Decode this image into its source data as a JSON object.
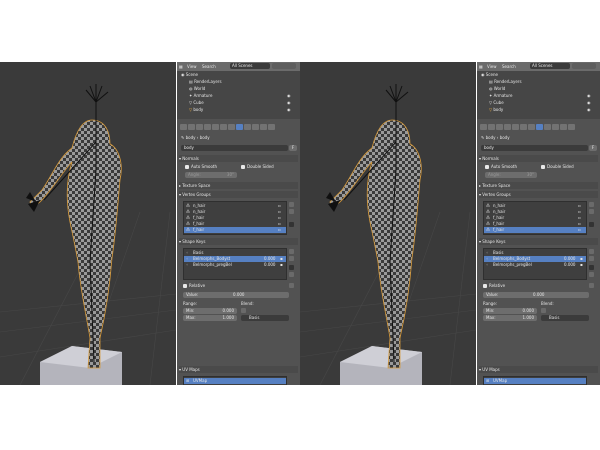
{
  "outliner": {
    "view_menu": "View",
    "search_menu": "Search",
    "scenes_filter": "All Scenes",
    "items": [
      {
        "label": "Scene",
        "indent": 0
      },
      {
        "label": "RenderLayers",
        "indent": 1
      },
      {
        "label": "World",
        "indent": 1
      },
      {
        "label": "Armature",
        "indent": 1
      },
      {
        "label": "Cube",
        "indent": 1
      },
      {
        "label": "body",
        "indent": 1
      }
    ]
  },
  "properties": {
    "breadcrumb_object": "body",
    "breadcrumb_mesh": "body",
    "mesh_name": "body",
    "mesh_badge": "F",
    "normals": {
      "title": "Normals",
      "auto_smooth": "Auto Smooth",
      "double_sided": "Double Sided",
      "angle": "Angle:",
      "angle_value": "30°"
    },
    "texture_space": "Texture Space",
    "vertex_groups": {
      "title": "Vertex Groups",
      "items": [
        "n_hair",
        "n_hair",
        "f_hair",
        "f_hair",
        "f_hair"
      ],
      "selected_index": 4
    },
    "shape_keys": {
      "title": "Shape Keys",
      "items": [
        {
          "name": "Basis",
          "value": ""
        },
        {
          "name": "Belmorphs_Bodyst",
          "value": "0.000"
        },
        {
          "name": "Belmorphs_pregBel",
          "value": "0.000"
        }
      ],
      "selected_index": 1,
      "relative": "Relative",
      "value_label": "Value:",
      "value": "0.000",
      "range_label": "Range:",
      "blend_label": "Blend:",
      "min_label": "Min:",
      "min_value": "0.000",
      "max_label": "Max:",
      "max_value": "1.000",
      "blend_value": "Basis"
    },
    "uv_maps": {
      "title": "UV Maps",
      "items": [
        "UVMap"
      ]
    }
  },
  "colors": {
    "viewport_bg": "#3a3a3a",
    "panel_bg": "#525252",
    "selection": "#5680c2",
    "armature": "#111111",
    "outline": "#d79a3a"
  }
}
